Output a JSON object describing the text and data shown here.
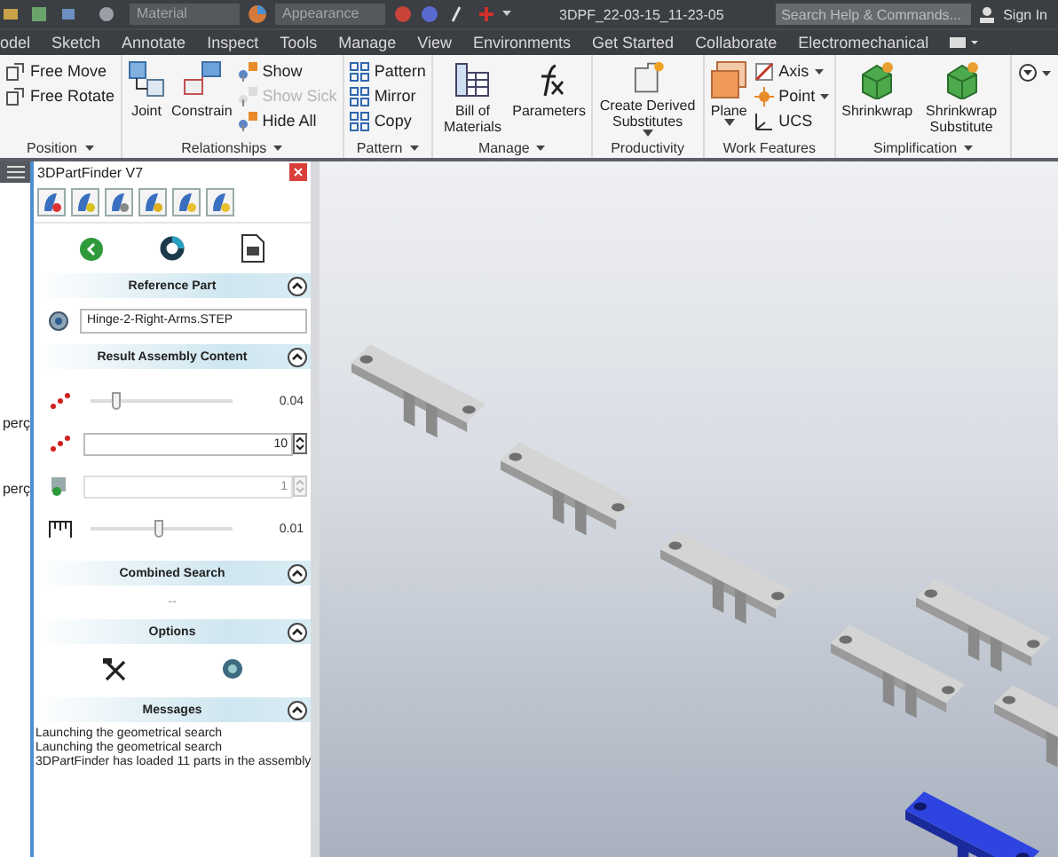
{
  "title_bar": {
    "material": "Material",
    "appearance": "Appearance",
    "title": "3DPF_22-03-15_11-23-05",
    "search_placeholder": "Search Help & Commands...",
    "sign_in": "Sign In"
  },
  "tabs": [
    {
      "label": "odel",
      "selected": false
    },
    {
      "label": "Sketch",
      "selected": false
    },
    {
      "label": "Annotate",
      "selected": false
    },
    {
      "label": "Inspect",
      "selected": false
    },
    {
      "label": "Tools",
      "selected": false
    },
    {
      "label": "Manage",
      "selected": false
    },
    {
      "label": "View",
      "selected": false
    },
    {
      "label": "Environments",
      "selected": false
    },
    {
      "label": "Get Started",
      "selected": false
    },
    {
      "label": "Collaborate",
      "selected": false
    },
    {
      "label": "Electromechanical",
      "selected": false
    }
  ],
  "ribbon": [
    {
      "label": "Position",
      "menu": true,
      "items": [
        {
          "kind": "small",
          "label": "Free Move",
          "disabled": false,
          "dropdown": false
        },
        {
          "kind": "small",
          "label": "Free Rotate",
          "disabled": false,
          "dropdown": false
        }
      ]
    },
    {
      "label": "Relationships",
      "menu": true,
      "items": [
        {
          "kind": "large",
          "label": "Joint",
          "disabled": false,
          "dropdown": false
        },
        {
          "kind": "large",
          "label": "Constrain",
          "disabled": false,
          "dropdown": false
        },
        {
          "kind": "small",
          "label": "Show",
          "disabled": false,
          "dropdown": false
        },
        {
          "kind": "small",
          "label": "Show Sick",
          "disabled": true,
          "dropdown": false
        },
        {
          "kind": "small",
          "label": "Hide All",
          "disabled": false,
          "dropdown": false
        }
      ]
    },
    {
      "label": "Pattern",
      "menu": true,
      "items": [
        {
          "kind": "small",
          "label": "Pattern",
          "disabled": false,
          "dropdown": false
        },
        {
          "kind": "small",
          "label": "Mirror",
          "disabled": false,
          "dropdown": false
        },
        {
          "kind": "small",
          "label": "Copy",
          "disabled": false,
          "dropdown": false
        }
      ]
    },
    {
      "label": "Manage",
      "menu": true,
      "items": [
        {
          "kind": "large",
          "label": "Bill of Materials",
          "disabled": false,
          "dropdown": false
        },
        {
          "kind": "large",
          "label": "Parameters",
          "disabled": false,
          "dropdown": false
        }
      ]
    },
    {
      "label": "Productivity",
      "menu": false,
      "items": [
        {
          "kind": "large",
          "label": "Create Derived Substitutes",
          "disabled": false,
          "dropdown": true
        }
      ]
    },
    {
      "label": "Work Features",
      "menu": false,
      "items": [
        {
          "kind": "large",
          "label": "Plane",
          "disabled": false,
          "dropdown": true
        },
        {
          "kind": "small",
          "label": "Axis",
          "disabled": false,
          "dropdown": true
        },
        {
          "kind": "small",
          "label": "Point",
          "disabled": false,
          "dropdown": true
        },
        {
          "kind": "small",
          "label": "UCS",
          "disabled": false,
          "dropdown": false
        }
      ]
    },
    {
      "label": "Simplification",
      "menu": true,
      "items": [
        {
          "kind": "large",
          "label": "Shrinkwrap",
          "disabled": false,
          "dropdown": false
        },
        {
          "kind": "large",
          "label": "Shrinkwrap Substitute",
          "disabled": false,
          "dropdown": false
        }
      ]
    }
  ],
  "browser": {
    "lines": [
      "perç",
      "perç"
    ]
  },
  "part_finder": {
    "title": "3DPartFinder V7",
    "sections": [
      {
        "kind": "reference",
        "title": "Reference Part",
        "expanded": true,
        "value": "Hinge-2-Right-Arms.STEP"
      },
      {
        "kind": "result",
        "title": "Result Assembly Content",
        "expanded": true,
        "rows": [
          {
            "kind": "slider",
            "level": 0.17,
            "reading": "0.04"
          },
          {
            "kind": "spin",
            "value": "10",
            "disabled": false
          },
          {
            "kind": "spin",
            "value": "1",
            "disabled": true
          },
          {
            "kind": "slider",
            "level": 0.48,
            "reading": "0.01"
          }
        ]
      },
      {
        "kind": "combined",
        "title": "Combined Search",
        "expanded": true,
        "text": "--"
      },
      {
        "kind": "options",
        "title": "Options",
        "expanded": true
      },
      {
        "kind": "messages",
        "title": "Messages",
        "expanded": true,
        "lines": [
          "Launching the geometrical search",
          "Launching the geometrical search",
          "3DPartFinder has loaded 11 parts in the assembly"
        ]
      }
    ]
  },
  "viewport": {
    "parts": [
      {
        "selected": false
      },
      {
        "selected": false
      },
      {
        "selected": false
      },
      {
        "selected": false
      },
      {
        "selected": false
      },
      {
        "selected": false
      },
      {
        "selected": true
      }
    ]
  }
}
